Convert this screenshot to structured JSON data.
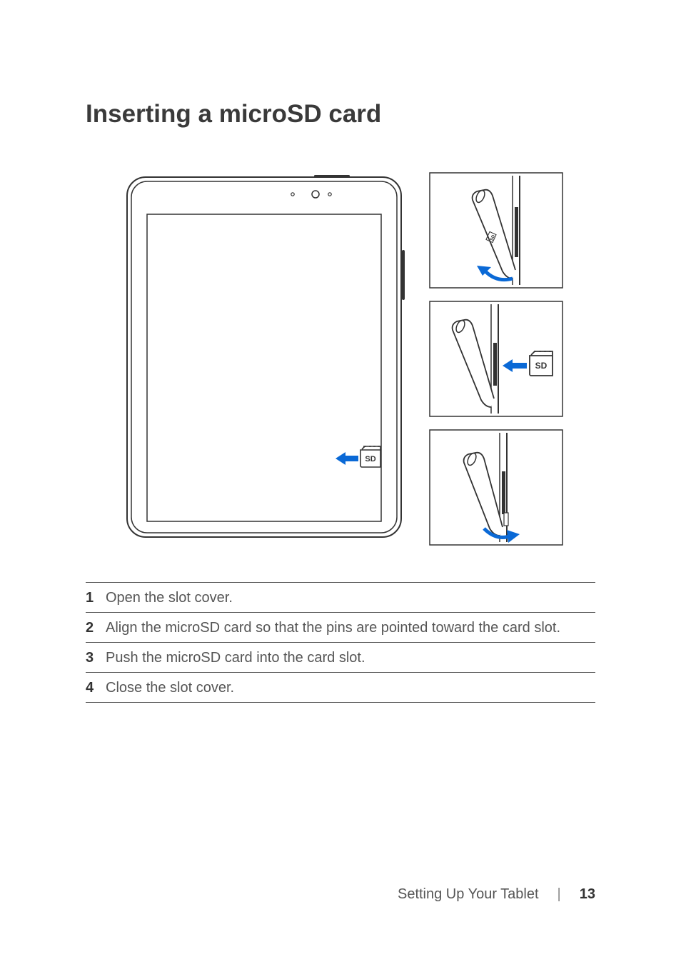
{
  "title": "Inserting a microSD card",
  "diagram": {
    "sd_label": "SD"
  },
  "steps": [
    {
      "n": "1",
      "text": "Open the slot cover."
    },
    {
      "n": "2",
      "text": "Align the microSD card so that the pins are pointed toward the card slot."
    },
    {
      "n": "3",
      "text": "Push the microSD card into the card slot."
    },
    {
      "n": "4",
      "text": "Close the slot cover."
    }
  ],
  "footer": {
    "section": "Setting Up Your Tablet",
    "page": "13"
  }
}
